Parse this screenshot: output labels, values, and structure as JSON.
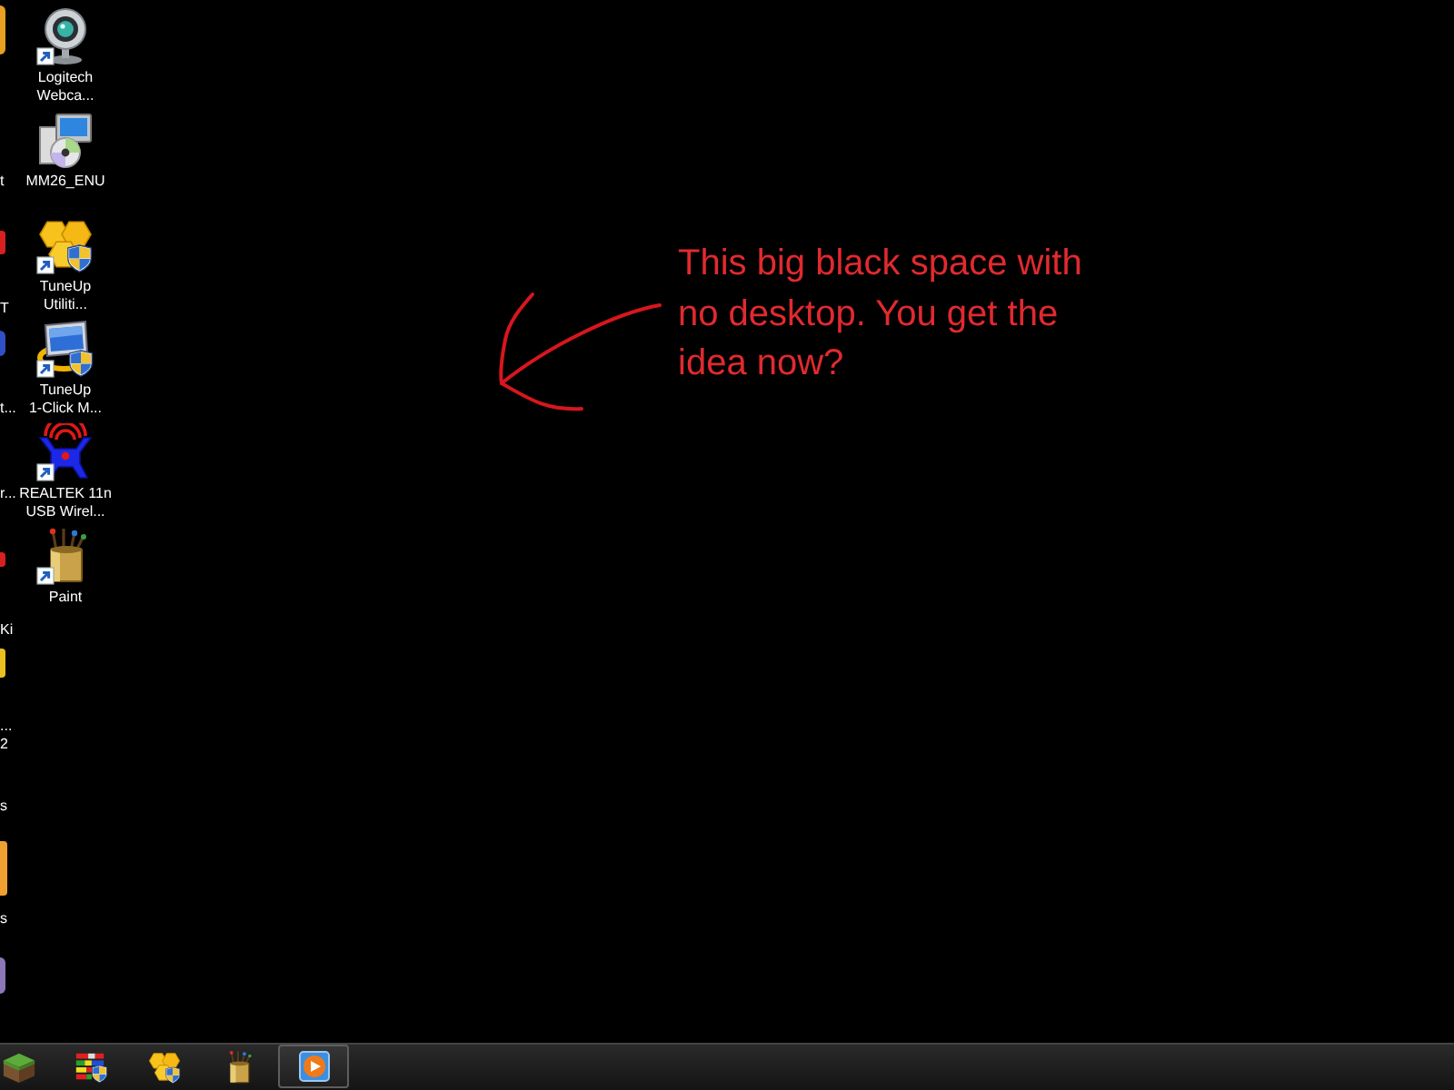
{
  "cut_off_column": [
    {
      "partial_icon": true
    },
    {
      "partial_icon": false,
      "label_lines": [
        "t"
      ]
    },
    {
      "partial_icon": true,
      "label_lines": [
        "T"
      ]
    },
    {
      "partial_icon": true,
      "label_lines": [
        "t..."
      ]
    },
    {
      "partial_icon": false,
      "label_lines": [
        "r..."
      ]
    },
    {
      "partial_icon": true,
      "label_lines": [
        "Ki"
      ]
    },
    {
      "partial_icon": true,
      "label_lines": [
        "...",
        "2"
      ]
    },
    {
      "partial_icon": false,
      "label_lines": [
        "s"
      ]
    },
    {
      "partial_icon": true,
      "label_lines": [
        "s"
      ]
    },
    {
      "partial_icon": true
    }
  ],
  "desktop_icons": [
    {
      "label": "Logitech Webca...",
      "shortcut": true
    },
    {
      "label": "MM26_ENU",
      "shortcut": false
    },
    {
      "label": "TuneUp Utiliti...",
      "shortcut": true
    },
    {
      "label": "TuneUp 1-Click M...",
      "shortcut": true
    },
    {
      "label": "REALTEK 11n USB Wirel...",
      "shortcut": true
    },
    {
      "label": "Paint",
      "shortcut": true
    }
  ],
  "annotation": {
    "text": "This big black space with no desktop. You get the idea now?"
  },
  "taskbar": {
    "items": [
      {
        "selected": false
      },
      {
        "selected": false
      },
      {
        "selected": false
      },
      {
        "selected": false
      },
      {
        "selected": true
      }
    ]
  }
}
